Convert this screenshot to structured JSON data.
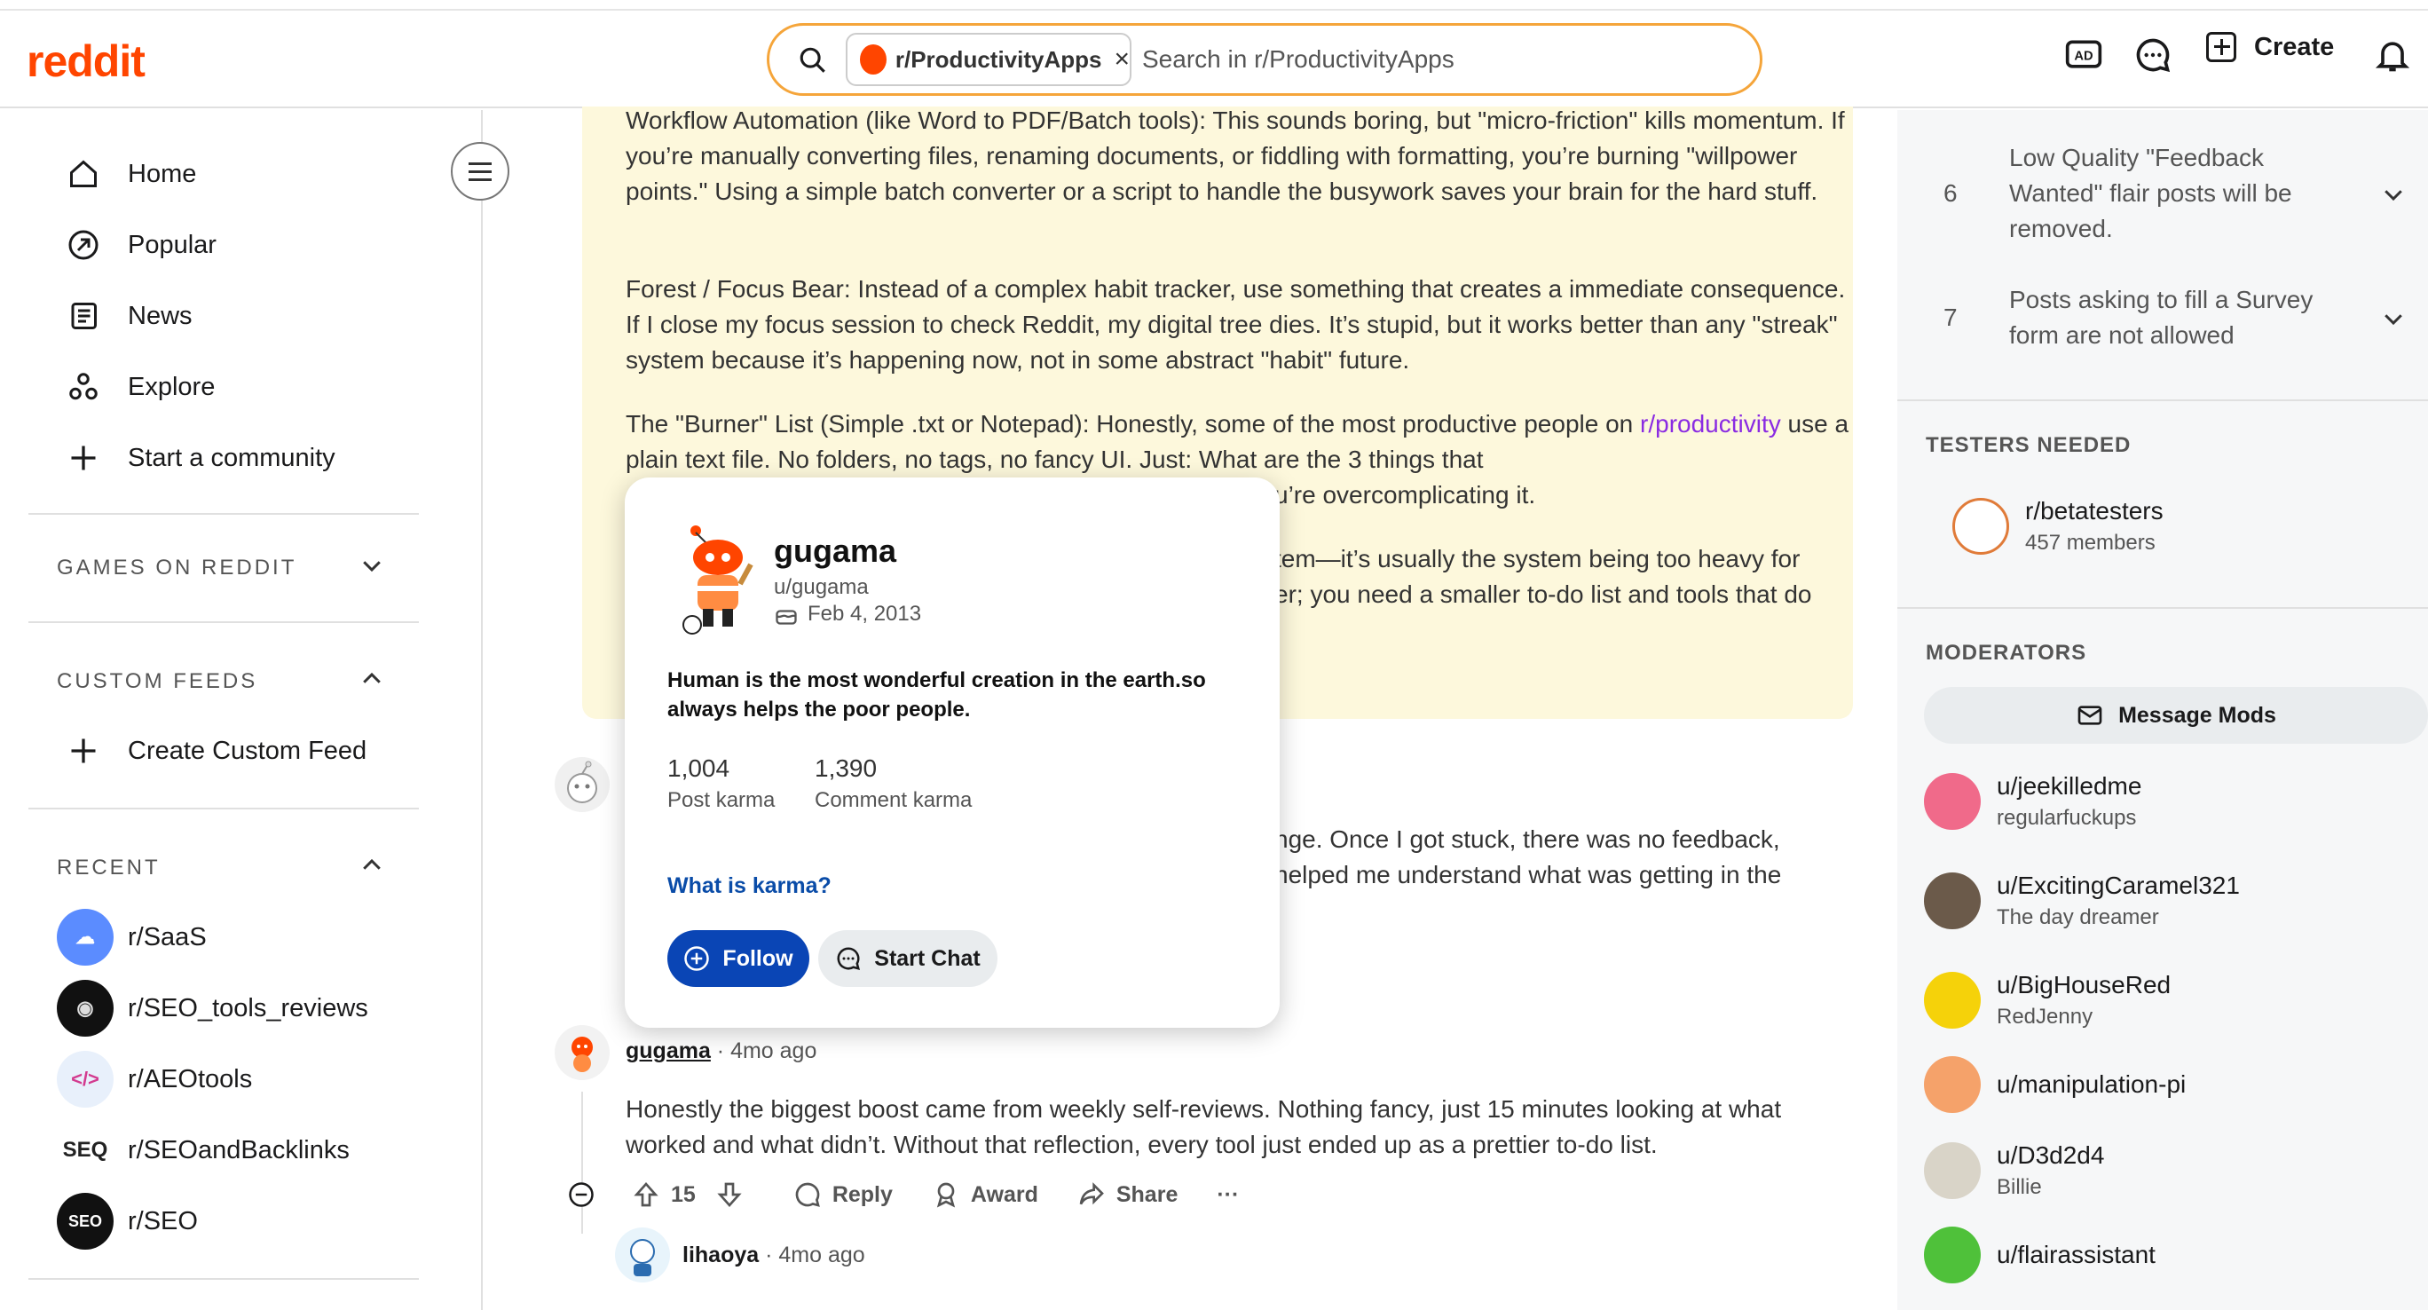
{
  "header": {
    "logo": "reddit",
    "community_chip": "r/ProductivityApps",
    "search_placeholder": "Search in r/ProductivityApps",
    "create_label": "Create"
  },
  "left_nav": {
    "items": [
      "Home",
      "Popular",
      "News",
      "Explore",
      "Start a community"
    ],
    "games_header": "GAMES ON REDDIT",
    "custom_feeds_header": "CUSTOM FEEDS",
    "create_custom_feed": "Create Custom Feed",
    "recent_header": "RECENT",
    "recent": [
      "r/SaaS",
      "r/SEO_tools_reviews",
      "r/AEOtools",
      "r/SEOandBacklinks",
      "r/SEO"
    ]
  },
  "post": {
    "p1": "Workflow Automation (like Word to PDF/Batch tools): This sounds boring, but \"micro-friction\" kills momentum. If you’re manually converting files, renaming documents, or fiddling with formatting, you’re burning \"willpower points.\" Using a simple batch converter or a script to handle the busywork saves your brain for the hard stuff.",
    "p2": "Forest / Focus Bear: Instead of a complex habit tracker, use something that creates a immediate consequence. If I close my focus session to check Reddit, my digital tree dies. It’s stupid, but it works better than any \"streak\" system because it’s happening now, not in some abstract \"habit\" future.",
    "p3_start": "The \"Burner\" List (Simple .txt or Notepad): Honestly, some of the most productive people on ",
    "p3_link": "r/productivity",
    "p3_end": " use a plain text file. No folders, no tags, no fancy UI. Just: What are the 3 things that",
    "p3_tail": "u’re overcomplicating it.",
    "p4_tail_a": "tem—it’s usually the system being too heavy for",
    "p4_tail_b": "er; you need a smaller to-do list and tools that do"
  },
  "comment1": {
    "tail_a": "nge. Once I got stuck, there was no feedback,",
    "tail_b": "helped me understand what was getting in the"
  },
  "comment2": {
    "user": "gugama",
    "time": "4mo ago",
    "text": "Honestly the biggest boost came from weekly self-reviews. Nothing fancy, just 15 minutes looking at what worked and what didn’t. Without that reflection, every tool just ended up as a prettier to-do list.",
    "votes": "15",
    "reply": "Reply",
    "award": "Award",
    "share": "Share",
    "more": "···"
  },
  "comment3": {
    "user": "lihaoya",
    "time": "4mo ago"
  },
  "popup": {
    "name": "gugama",
    "username": "u/gugama",
    "date": "Feb 4, 2013",
    "bio": "Human is the most wonderful creation in the earth.so always helps the poor people.",
    "post_karma": "1,004",
    "post_karma_label": "Post karma",
    "comment_karma": "1,390",
    "comment_karma_label": "Comment karma",
    "what_is_karma": "What is karma?",
    "follow": "Follow",
    "start_chat": "Start Chat"
  },
  "right": {
    "rules": [
      {
        "num": "6",
        "text": "Low Quality \"Feedback Wanted\" flair posts will be removed."
      },
      {
        "num": "7",
        "text": "Posts asking to fill a Survey form are not allowed"
      }
    ],
    "testers_header": "TESTERS NEEDED",
    "testers_name": "r/betatesters",
    "testers_members": "457 members",
    "mods_header": "MODERATORS",
    "message_mods": "Message Mods",
    "mods": [
      {
        "name": "u/jeekilledme",
        "flair": "regularfuckups"
      },
      {
        "name": "u/ExcitingCaramel321",
        "flair": "The day dreamer"
      },
      {
        "name": "u/BigHouseRed",
        "flair": "RedJenny"
      },
      {
        "name": "u/manipulation-pi",
        "flair": ""
      },
      {
        "name": "u/D3d2d4",
        "flair": "Billie"
      },
      {
        "name": "u/flairassistant",
        "flair": ""
      }
    ]
  },
  "colors": {
    "brand": "#ff4500",
    "post_bg": "#fdf8dc",
    "follow_bg": "#0a45b5",
    "link": "#8a2be2"
  }
}
